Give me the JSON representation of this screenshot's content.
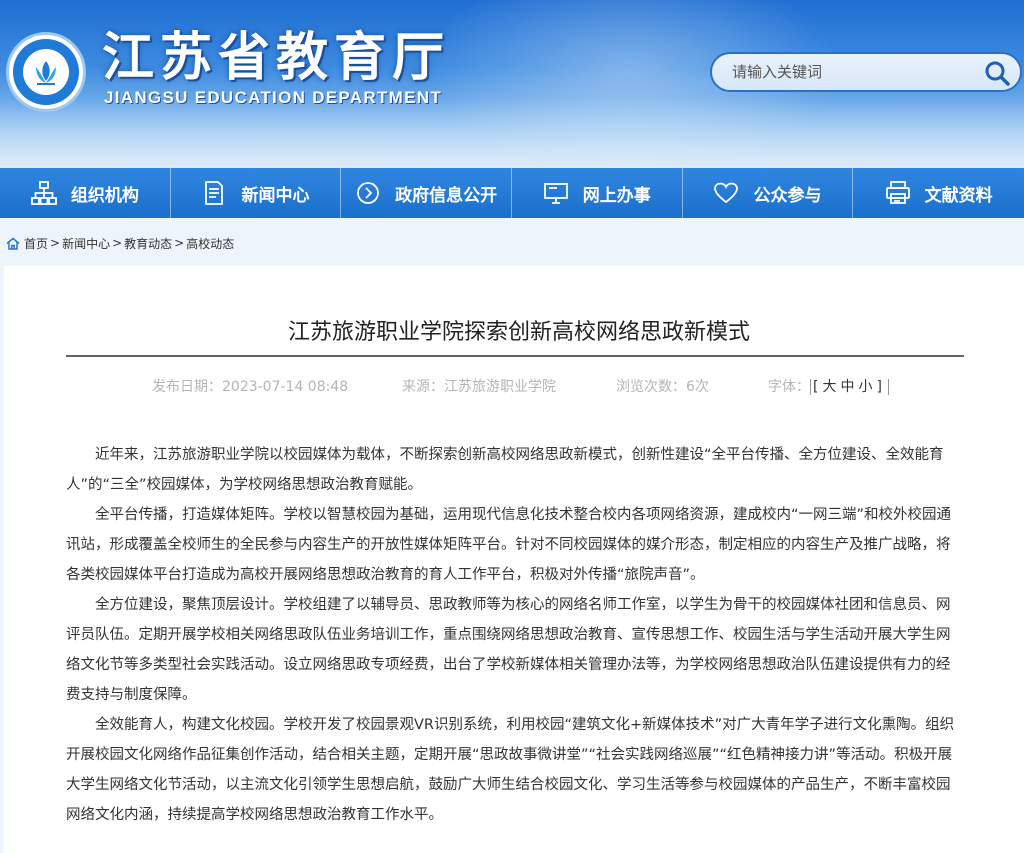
{
  "header": {
    "title": "江苏省教育厅",
    "subtitle": "JIANGSU EDUCATION DEPARTMENT",
    "logo_icon": "emblem-icon"
  },
  "search": {
    "placeholder": "请输入关键词",
    "icon": "search-icon"
  },
  "nav": {
    "items": [
      {
        "label": "组织机构",
        "icon": "org-chart-icon"
      },
      {
        "label": "新闻中心",
        "icon": "document-icon"
      },
      {
        "label": "政府信息公开",
        "icon": "play-circle-icon"
      },
      {
        "label": "网上办事",
        "icon": "monitor-icon"
      },
      {
        "label": "公众参与",
        "icon": "heart-icon"
      },
      {
        "label": "文献资料",
        "icon": "printer-icon"
      }
    ]
  },
  "breadcrumb": {
    "icon": "home-icon",
    "items": [
      "首页",
      "新闻中心",
      "教育动态",
      "高校动态"
    ],
    "separator": ">"
  },
  "article": {
    "title": "江苏旅游职业学院探索创新高校网络思政新模式",
    "meta": {
      "date_label": "发布日期：",
      "date": "2023-07-14 08:48",
      "source_label": "来源：",
      "source": "江苏旅游职业学院",
      "views_label": "浏览次数：",
      "views": "6次",
      "font_label": "字体：",
      "font_open": "[",
      "font_large": "大",
      "font_medium": "中",
      "font_small": "小",
      "font_close": "]"
    },
    "paragraphs": [
      "近年来，江苏旅游职业学院以校园媒体为载体，不断探索创新高校网络思政新模式，创新性建设“全平台传播、全方位建设、全效能育人”的“三全”校园媒体，为学校网络思想政治教育赋能。",
      "全平台传播，打造媒体矩阵。学校以智慧校园为基础，运用现代信息化技术整合校内各项网络资源，建成校内“一网三端”和校外校园通讯站，形成覆盖全校师生的全民参与内容生产的开放性媒体矩阵平台。针对不同校园媒体的媒介形态，制定相应的内容生产及推广战略，将各类校园媒体平台打造成为高校开展网络思想政治教育的育人工作平台，积极对外传播“旅院声音”。",
      "全方位建设，聚焦顶层设计。学校组建了以辅导员、思政教师等为核心的网络名师工作室，以学生为骨干的校园媒体社团和信息员、网评员队伍。定期开展学校相关网络思政队伍业务培训工作，重点围绕网络思想政治教育、宣传思想工作、校园生活与学生活动开展大学生网络文化节等多类型社会实践活动。设立网络思政专项经费，出台了学校新媒体相关管理办法等，为学校网络思想政治队伍建设提供有力的经费支持与制度保障。",
      "全效能育人，构建文化校园。学校开发了校园景观VR识别系统，利用校园“建筑文化+新媒体技术”对广大青年学子进行文化熏陶。组织开展校园文化网络作品征集创作活动，结合相关主题，定期开展“思政故事微讲堂”“社会实践网络巡展”“红色精神接力讲”等活动。积极开展大学生网络文化节活动，以主流文化引领学生思想启航，鼓励广大师生结合校园文化、学习生活等参与校园媒体的产品生产，不断丰富校园网络文化内涵，持续提高学校网络思想政治教育工作水平。"
    ]
  },
  "colors": {
    "nav_bg": "#1b6fcc",
    "header_top": "#1f6fd2",
    "body_bg": "#eef4fb"
  }
}
